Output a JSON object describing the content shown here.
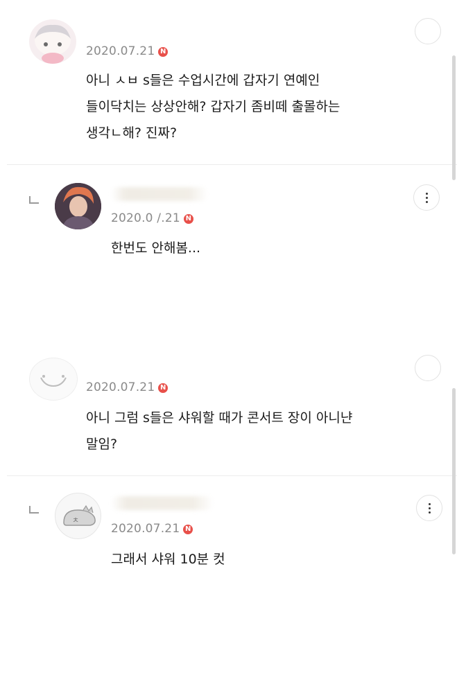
{
  "comments": [
    {
      "date": "2020.07.21",
      "badge": "N",
      "text": "아니 ㅅㅂ s들은 수업시간에 갑자기 연예인\n들이닥치는 상상안해? 갑자기 좀비떼 출몰하는\n생각ㄴ해? 진짜?"
    },
    {
      "date": "2020.0 /.21",
      "badge": "N",
      "text": "한번도 안해봄..."
    },
    {
      "date": "2020.07.21",
      "badge": "N",
      "text": "아니 그럼 s들은 샤워할 때가 콘서트 장이 아니냔\n말임?"
    },
    {
      "date": "2020.07.21",
      "badge": "N",
      "text": "그래서 샤워 10분 컷"
    }
  ],
  "reply_avatar_glyph": "ㅊ",
  "icons": [
    "more-vertical-icon",
    "reply-arrow-icon",
    "new-badge-icon"
  ],
  "colors": {
    "badge": "#e8504a",
    "date": "#8a8a8a",
    "text": "#1b1b1b"
  }
}
